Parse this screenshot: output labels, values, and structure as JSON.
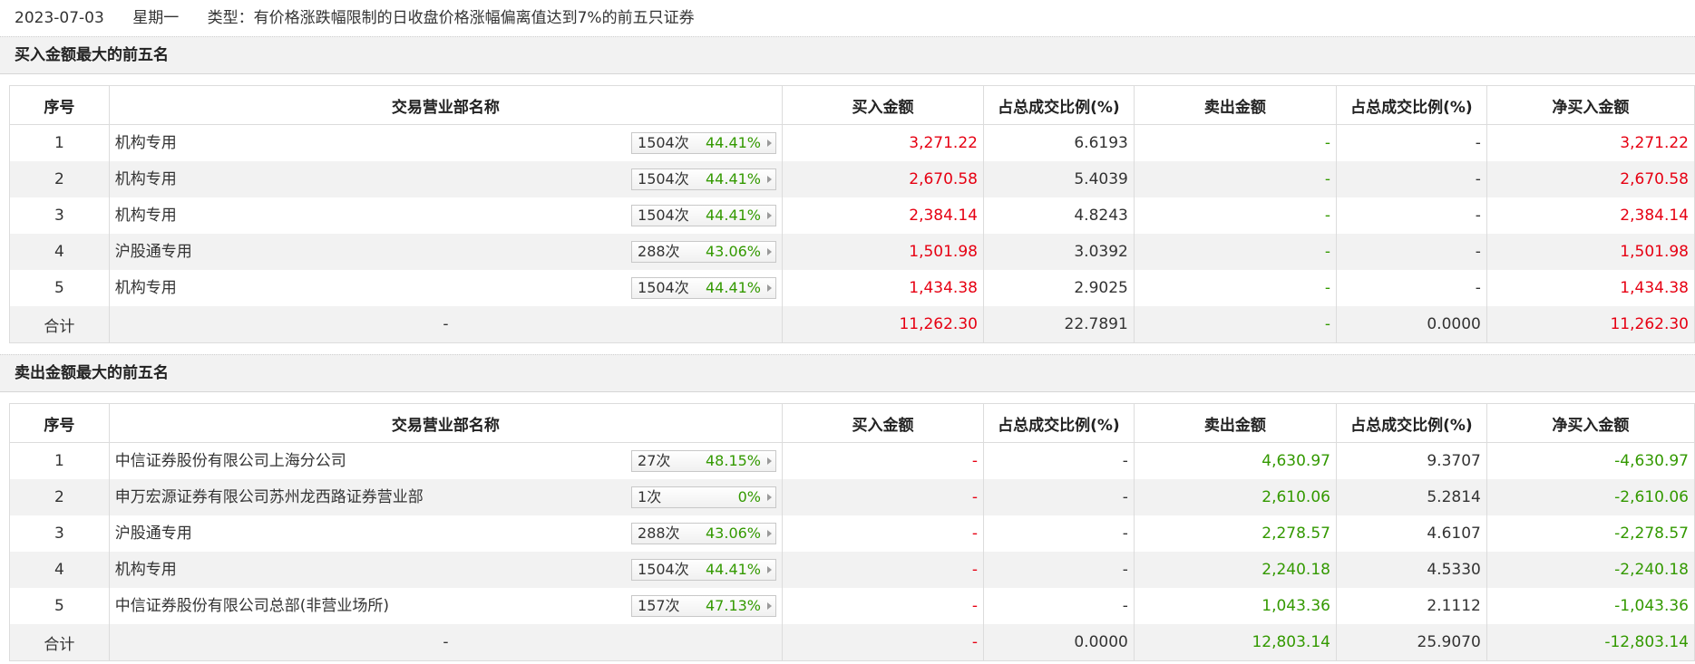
{
  "header": {
    "date": "2023-07-03",
    "weekday": "星期一",
    "type_text": "类型：有价格涨跌幅限制的日收盘价格涨幅偏离值达到7%的前五只证券"
  },
  "columns": {
    "seq": "序号",
    "name": "交易营业部名称",
    "buy": "买入金额",
    "buy_ratio": "占总成交比例(%)",
    "sell": "卖出金额",
    "sell_ratio": "占总成交比例(%)",
    "net": "净买入金额"
  },
  "buy_section": {
    "title": "买入金额最大的前五名",
    "rows": [
      {
        "seq": "1",
        "name": "机构专用",
        "count": "1504次",
        "pct": "44.41%",
        "buy": "3,271.22",
        "buy_ratio": "6.6193",
        "sell": "-",
        "sell_ratio": "-",
        "net": "3,271.22"
      },
      {
        "seq": "2",
        "name": "机构专用",
        "count": "1504次",
        "pct": "44.41%",
        "buy": "2,670.58",
        "buy_ratio": "5.4039",
        "sell": "-",
        "sell_ratio": "-",
        "net": "2,670.58"
      },
      {
        "seq": "3",
        "name": "机构专用",
        "count": "1504次",
        "pct": "44.41%",
        "buy": "2,384.14",
        "buy_ratio": "4.8243",
        "sell": "-",
        "sell_ratio": "-",
        "net": "2,384.14"
      },
      {
        "seq": "4",
        "name": "沪股通专用",
        "count": "288次",
        "pct": "43.06%",
        "buy": "1,501.98",
        "buy_ratio": "3.0392",
        "sell": "-",
        "sell_ratio": "-",
        "net": "1,501.98"
      },
      {
        "seq": "5",
        "name": "机构专用",
        "count": "1504次",
        "pct": "44.41%",
        "buy": "1,434.38",
        "buy_ratio": "2.9025",
        "sell": "-",
        "sell_ratio": "-",
        "net": "1,434.38"
      }
    ],
    "total": {
      "label": "合计",
      "name": "-",
      "buy": "11,262.30",
      "buy_ratio": "22.7891",
      "sell": "-",
      "sell_ratio": "0.0000",
      "net": "11,262.30"
    }
  },
  "sell_section": {
    "title": "卖出金额最大的前五名",
    "rows": [
      {
        "seq": "1",
        "name": "中信证券股份有限公司上海分公司",
        "count": "27次",
        "pct": "48.15%",
        "buy": "-",
        "buy_ratio": "-",
        "sell": "4,630.97",
        "sell_ratio": "9.3707",
        "net": "-4,630.97"
      },
      {
        "seq": "2",
        "name": "申万宏源证券有限公司苏州龙西路证券营业部",
        "count": "1次",
        "pct": "0%",
        "buy": "-",
        "buy_ratio": "-",
        "sell": "2,610.06",
        "sell_ratio": "5.2814",
        "net": "-2,610.06"
      },
      {
        "seq": "3",
        "name": "沪股通专用",
        "count": "288次",
        "pct": "43.06%",
        "buy": "-",
        "buy_ratio": "-",
        "sell": "2,278.57",
        "sell_ratio": "4.6107",
        "net": "-2,278.57"
      },
      {
        "seq": "4",
        "name": "机构专用",
        "count": "1504次",
        "pct": "44.41%",
        "buy": "-",
        "buy_ratio": "-",
        "sell": "2,240.18",
        "sell_ratio": "4.5330",
        "net": "-2,240.18"
      },
      {
        "seq": "5",
        "name": "中信证券股份有限公司总部(非营业场所)",
        "count": "157次",
        "pct": "47.13%",
        "buy": "-",
        "buy_ratio": "-",
        "sell": "1,043.36",
        "sell_ratio": "2.1112",
        "net": "-1,043.36"
      }
    ],
    "total": {
      "label": "合计",
      "name": "-",
      "buy": "-",
      "buy_ratio": "0.0000",
      "sell": "12,803.14",
      "sell_ratio": "25.9070",
      "net": "-12,803.14"
    }
  },
  "colors": {
    "red": "#e60012",
    "green": "#339900",
    "row_alt": "#f2f2f2"
  }
}
